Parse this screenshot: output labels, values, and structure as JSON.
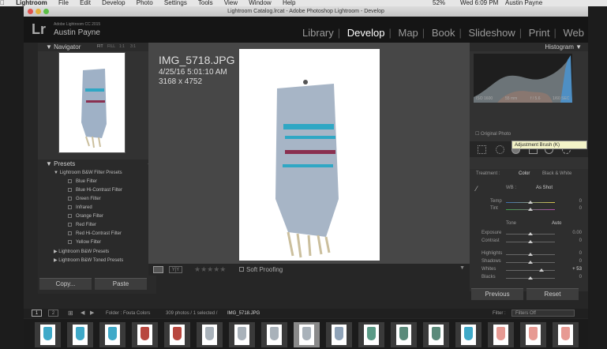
{
  "menubar": {
    "apple": "",
    "items": [
      "Lightroom",
      "File",
      "Edit",
      "Develop",
      "Photo",
      "Settings",
      "Tools",
      "View",
      "Window",
      "Help"
    ],
    "status": "52%",
    "clock": "Wed 6:09 PM",
    "user": "Austin Payne"
  },
  "window": {
    "title": "Lightroom Catalog.lrcat - Adobe Photoshop Lightroom - Develop"
  },
  "identity": {
    "logo": "Lr",
    "version": "Adobe Lightroom CC 2015",
    "user": "Austin Payne"
  },
  "modules": [
    "Library",
    "Develop",
    "Map",
    "Book",
    "Slideshow",
    "Print",
    "Web"
  ],
  "navigator": {
    "title": "Navigator",
    "zoom": [
      "FIT",
      "FILL",
      "1:1",
      "3:1"
    ]
  },
  "presets": {
    "title": "Presets",
    "group1": "Lightroom B&W Filter Presets",
    "items": [
      "Blue Filter",
      "Blue Hi-Contrast Filter",
      "Green Filter",
      "Infrared",
      "Orange Filter",
      "Red Filter",
      "Red Hi-Contrast Filter",
      "Yellow Filter"
    ],
    "group2": "Lightroom B&W Presets",
    "group3": "Lightroom B&W Toned Presets"
  },
  "left_buttons": {
    "copy": "Copy...",
    "paste": "Paste"
  },
  "image": {
    "name": "IMG_5718.JPG",
    "date": "4/25/16 5:01:10 AM",
    "dims": "3168 x 4752"
  },
  "histogram": {
    "title": "Histogram",
    "iso": "ISO 1600",
    "focal": "55 mm",
    "aperture": "f / 5.6",
    "shutter": "1/60 SEC",
    "original": "Original Photo"
  },
  "tooltip": "Adjustment Brush (K)",
  "basic": {
    "treatment": "Treatment :",
    "color": "Color",
    "bw": "Black & White",
    "wb": "WB :",
    "wb_val": "As Shot",
    "temp": "Temp",
    "tint": "Tint",
    "tone": "Tone",
    "auto": "Auto",
    "exposure": "Exposure",
    "exposure_val": "0.00",
    "contrast": "Contrast",
    "contrast_val": "0",
    "highlights": "Highlights",
    "highlights_val": "0",
    "shadows": "Shadows",
    "shadows_val": "0",
    "whites": "Whites",
    "whites_val": "+ 53",
    "blacks": "Blacks",
    "blacks_val": "0",
    "temp_val": "0",
    "tint_val": "0"
  },
  "right_buttons": {
    "previous": "Previous",
    "reset": "Reset"
  },
  "toolbar": {
    "softproof": "Soft Proofing"
  },
  "filmstrip": {
    "folder": "Folder : Fouta Colors",
    "count": "309 photos / 1 selected /",
    "selected": "IMG_5718.JPG",
    "filter_label": "Filter :",
    "filter_val": "Filters Off",
    "pages": [
      "1",
      "2"
    ]
  },
  "colors": {
    "teal": "#3fa9c8",
    "red": "#b8473f",
    "grey": "#a9b2ba",
    "pink": "#e79a93"
  }
}
